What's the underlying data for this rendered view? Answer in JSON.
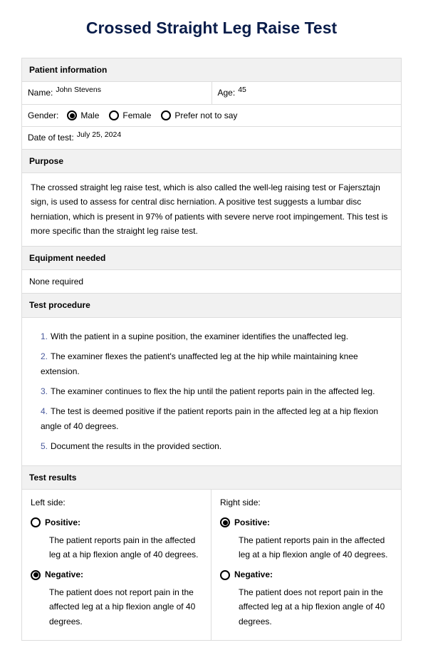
{
  "title": "Crossed Straight Leg Raise Test",
  "patient_info": {
    "header": "Patient information",
    "name_label": "Name:",
    "name_value": "John Stevens",
    "age_label": "Age:",
    "age_value": "45",
    "gender_label": "Gender:",
    "gender_options": {
      "male": "Male",
      "female": "Female",
      "pnts": "Prefer not to say"
    },
    "date_label": "Date of test:",
    "date_value": "July 25, 2024"
  },
  "purpose": {
    "header": "Purpose",
    "text": "The crossed straight leg raise test, which is also called the well-leg raising test or Fajersztajn sign, is used to assess for central disc herniation. A positive test suggests a lumbar disc herniation, which is present in 97% of patients with severe nerve root impingement. This test is more specific than the straight leg raise test."
  },
  "equipment": {
    "header": "Equipment needed",
    "text": "None required"
  },
  "procedure": {
    "header": "Test procedure",
    "steps": [
      "With the patient in a supine position, the examiner identifies the unaffected leg.",
      "The examiner flexes the patient's unaffected leg at the hip while maintaining knee extension.",
      "The examiner continues to flex the hip until the patient reports pain in the affected leg.",
      "The test is deemed positive if the patient reports pain in the affected leg at a hip flexion angle of 40 degrees.",
      "Document the results in the provided section."
    ]
  },
  "results": {
    "header": "Test results",
    "left_label": "Left side:",
    "right_label": "Right side:",
    "positive_label": "Positive:",
    "positive_desc": "The patient reports pain in the affected leg at a hip flexion angle of 40 degrees.",
    "negative_label": "Negative:",
    "negative_desc": "The patient does not report pain in the affected leg at a hip flexion angle of 40 degrees."
  }
}
